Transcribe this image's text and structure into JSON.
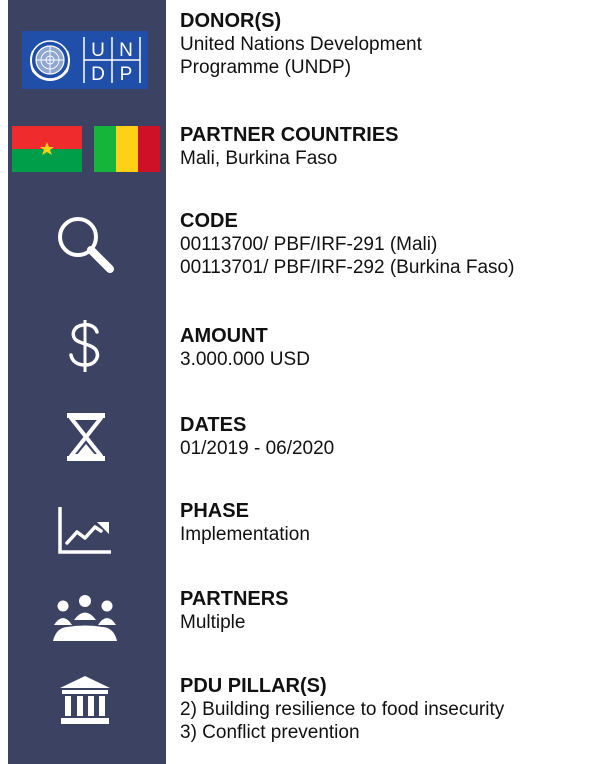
{
  "colors": {
    "sidebar": "#3c4261",
    "undp_blue": "#1f4fa8",
    "icon": "#ffffff",
    "burkina_red": "#ef2b2d",
    "burkina_green": "#009e49",
    "burkina_star": "#fcd116",
    "mali_green": "#14b53a",
    "mali_yellow": "#fcd116",
    "mali_red": "#ce1126"
  },
  "logo": {
    "letters": [
      "U",
      "N",
      "D",
      "P"
    ]
  },
  "sections": [
    {
      "label": "DONOR(S)",
      "icon": "undp-logo",
      "lines": [
        "United Nations Development",
        "Programme (UNDP)"
      ]
    },
    {
      "label": "PARTNER COUNTRIES",
      "icon": "country-flags",
      "lines": [
        "Mali, Burkina Faso"
      ]
    },
    {
      "label": "CODE",
      "icon": "search-icon",
      "lines": [
        "00113700/ PBF/IRF-291 (Mali)",
        "00113701/ PBF/IRF-292 (Burkina Faso)"
      ]
    },
    {
      "label": "AMOUNT",
      "icon": "dollar-icon",
      "lines": [
        "3.000.000 USD"
      ]
    },
    {
      "label": "DATES",
      "icon": "hourglass-icon",
      "lines": [
        "01/2019 - 06/2020"
      ]
    },
    {
      "label": "PHASE",
      "icon": "line-chart-icon",
      "lines": [
        "Implementation"
      ]
    },
    {
      "label": "PARTNERS",
      "icon": "people-icon",
      "lines": [
        "Multiple"
      ]
    },
    {
      "label": "PDU PILLAR(S)",
      "icon": "institution-icon",
      "lines": [
        "2) Building resilience to food insecurity",
        "3) Conflict prevention"
      ]
    }
  ]
}
